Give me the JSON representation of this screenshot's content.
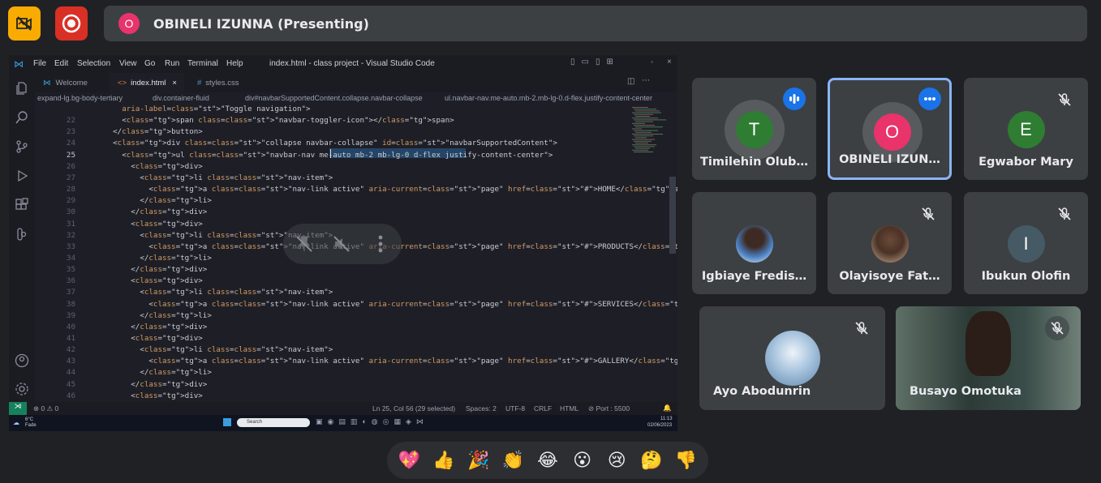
{
  "presenter": {
    "avatar_letter": "O",
    "label": "OBINELI IZUNNA (Presenting)"
  },
  "vscode": {
    "menu": [
      "File",
      "Edit",
      "Selection",
      "View",
      "Go",
      "Run",
      "Terminal",
      "Help"
    ],
    "window_title": "index.html - class project - Visual Studio Code",
    "tabs": [
      {
        "label": "Welcome",
        "icon": "≡"
      },
      {
        "label": "index.html",
        "icon": "<>"
      },
      {
        "label": "styles.css",
        "icon": "#"
      }
    ],
    "breadcrumbs": [
      "expand-lg.bg-body-tertiary",
      "div.container-fluid",
      "div#navbarSupportedContent.collapse.navbar-collapse",
      "ul.navbar-nav.me-auto.mb-2.mb-lg-0.d-flex.justify-content-center"
    ],
    "lines": [
      {
        "n": "",
        "text": "      aria-label=\"Toggle navigation\">"
      },
      {
        "n": "22",
        "text": "      <span class=\"navbar-toggler-icon\"></span>"
      },
      {
        "n": "23",
        "text": "    </button>"
      },
      {
        "n": "24",
        "text": "    <div class=\"collapse navbar-collapse\" id=\"navbarSupportedContent\">"
      },
      {
        "n": "25",
        "text": "      <ul class=\"navbar-nav me-auto mb-2 mb-lg-0 d-flex justify-content-center\">"
      },
      {
        "n": "26",
        "text": "        <div>"
      },
      {
        "n": "27",
        "text": "          <li class=\"nav-item\">"
      },
      {
        "n": "28",
        "text": "            <a class=\"nav-link active\" aria-current=\"page\" href=\"#\">HOME</a>"
      },
      {
        "n": "29",
        "text": "          </li>"
      },
      {
        "n": "30",
        "text": "        </div>"
      },
      {
        "n": "31",
        "text": "        <div>"
      },
      {
        "n": "32",
        "text": "          <li class=\"nav-item\">"
      },
      {
        "n": "33",
        "text": "            <a class=\"nav-link active\" aria-current=\"page\" href=\"#\">PRODUCTS</a>"
      },
      {
        "n": "34",
        "text": "          </li>"
      },
      {
        "n": "35",
        "text": "        </div>"
      },
      {
        "n": "36",
        "text": "        <div>"
      },
      {
        "n": "37",
        "text": "          <li class=\"nav-item\">"
      },
      {
        "n": "38",
        "text": "            <a class=\"nav-link active\" aria-current=\"page\" href=\"#\">SERVICES</a>"
      },
      {
        "n": "39",
        "text": "          </li>"
      },
      {
        "n": "40",
        "text": "        </div>"
      },
      {
        "n": "41",
        "text": "        <div>"
      },
      {
        "n": "42",
        "text": "          <li class=\"nav-item\">"
      },
      {
        "n": "43",
        "text": "            <a class=\"nav-link active\" aria-current=\"page\" href=\"#\">GALLERY</a>"
      },
      {
        "n": "44",
        "text": "          </li>"
      },
      {
        "n": "45",
        "text": "        </div>"
      },
      {
        "n": "46",
        "text": "        <div>"
      }
    ],
    "status": {
      "errors": "⊗ 0 ⚠ 0",
      "position": "Ln 25, Col 56 (29 selected)",
      "spaces": "Spaces: 2",
      "encoding": "UTF-8",
      "eol": "CRLF",
      "language": "HTML",
      "port": "⊘ Port : 5500"
    },
    "taskbar": {
      "weather_temp": "6°C",
      "weather_text": "Fade",
      "search": "Search",
      "time": "11:13",
      "date": "02/06/2023"
    }
  },
  "participants": [
    {
      "name": "Timilehin Olub…",
      "initial": "T",
      "avatar_color": "#2e7d32",
      "status": "speaking"
    },
    {
      "name": "OBINELI IZUN…",
      "initial": "O",
      "avatar_color": "#e8336b",
      "status": "more"
    },
    {
      "name": "Egwabor Mary",
      "initial": "E",
      "avatar_color": "#2e7d32",
      "status": "muted"
    },
    {
      "name": "Igbiaye Fredis…",
      "initial": "",
      "avatar_color": "#5d7fb0",
      "status": "none"
    },
    {
      "name": "Olayisoye Fat…",
      "initial": "",
      "avatar_color": "#8a6a55",
      "status": "muted"
    },
    {
      "name": "Ibukun Olofin",
      "initial": "I",
      "avatar_color": "#455a64",
      "status": "muted"
    },
    {
      "name": "Ayo Abodunrin",
      "initial": "",
      "avatar_color": "#7aa0c8",
      "status": "muted"
    },
    {
      "name": "Busayo Omotuka",
      "initial": "",
      "avatar_color": "#2a3f3a",
      "status": "muted"
    }
  ],
  "reactions": [
    "💖",
    "👍",
    "🎉",
    "👏",
    "😂",
    "😮",
    "😢",
    "🤔",
    "👎"
  ],
  "colors": {
    "background": "#202124",
    "tile": "#3c4043",
    "accent": "#8ab4f8",
    "record": "#d93025",
    "camera_off": "#f9ab00"
  }
}
